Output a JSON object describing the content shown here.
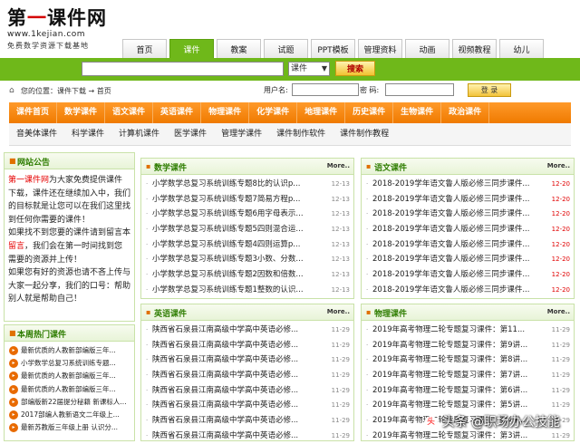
{
  "logo": {
    "title_a": "第",
    "title_b": "一",
    "title_c": "课件网",
    "domain": "www.1kejian.com",
    "slogan": "免费数学资源下载基地"
  },
  "nav": {
    "tabs": [
      "首页",
      "课件",
      "教案",
      "试题",
      "PPT模板",
      "管理资料",
      "动画",
      "视频教程",
      "幼儿"
    ],
    "active": 1
  },
  "search": {
    "select_value": "课件",
    "button": "搜索"
  },
  "infobar": {
    "location_label": "您的位置：课件下载 → 首页",
    "user_label": "用户名:",
    "pw_label": "密 码:",
    "login_button": "登 录"
  },
  "categories": {
    "row1": [
      "课件首页",
      "数学课件",
      "语文课件",
      "英语课件",
      "物理课件",
      "化学课件",
      "地理课件",
      "历史课件",
      "生物课件",
      "政治课件"
    ],
    "row2": [
      "音美体课件",
      "科学课件",
      "计算机课件",
      "医学课件",
      "管理学课件",
      "课件制作软件",
      "课件制作教程"
    ]
  },
  "announce": {
    "title": "网站公告",
    "site": "第一课件网",
    "p1": "为大家免费提供课件下载，课件还在继续加入中，我们的目标就是让您可以在我们这里找到任何你需要的课件！",
    "p2a": "如果找不到您要的课件请到留言本",
    "p2b": "留言",
    "p2c": "，我们会在第一时间找到您需要的资源并上传！",
    "p3": "如果您有好的资源也请不吝上传与大家一起分享，我们的口号：帮助别人就是帮助自己！"
  },
  "hot": {
    "title": "本周热门课件",
    "items": [
      "最新优质的人教新部编版三年...",
      "小学数学总复习系统训练专题...",
      "最新优质的人教新部编版三年...",
      "最新优质的人教新部编版三年...",
      "部编版新22届提分秘籍  新课标人...",
      "2017部编人教新语文二年级上...",
      "最新苏教版三年级上册 认识分..."
    ]
  },
  "sections": [
    {
      "title": "数学课件",
      "more": "More..",
      "items": [
        {
          "t": "小学数学总复习系统训练专题8比的认识p...",
          "d": "12-13"
        },
        {
          "t": "小学数学总复习系统训练专题7简易方程p...",
          "d": "12-13"
        },
        {
          "t": "小学数学总复习系统训练专题6用字母表示...",
          "d": "12-13"
        },
        {
          "t": "小学数学总复习系统训练专题5四则混合运...",
          "d": "12-13"
        },
        {
          "t": "小学数学总复习系统训练专题4四则运算p...",
          "d": "12-13"
        },
        {
          "t": "小学数学总复习系统训练专题3小数、分数...",
          "d": "12-13"
        },
        {
          "t": "小学数学总复习系统训练专题2因数和倍数...",
          "d": "12-13"
        },
        {
          "t": "小学数学总复习系统训练专题1整数的认识...",
          "d": "12-13"
        }
      ]
    },
    {
      "title": "语文课件",
      "more": "More..",
      "items": [
        {
          "t": "2018-2019学年语文鲁人版必修三同步课件...",
          "d": "12-20",
          "red": true
        },
        {
          "t": "2018-2019学年语文鲁人版必修三同步课件...",
          "d": "12-20",
          "red": true
        },
        {
          "t": "2018-2019学年语文鲁人版必修三同步课件...",
          "d": "12-20",
          "red": true
        },
        {
          "t": "2018-2019学年语文鲁人版必修三同步课件...",
          "d": "12-20",
          "red": true
        },
        {
          "t": "2018-2019学年语文鲁人版必修三同步课件...",
          "d": "12-20",
          "red": true
        },
        {
          "t": "2018-2019学年语文鲁人版必修三同步课件...",
          "d": "12-20",
          "red": true
        },
        {
          "t": "2018-2019学年语文鲁人版必修三同步课件...",
          "d": "12-20",
          "red": true
        },
        {
          "t": "2018-2019学年语文鲁人版必修三同步课件...",
          "d": "12-20",
          "red": true
        }
      ]
    },
    {
      "title": "英语课件",
      "more": "More..",
      "items": [
        {
          "t": "陕西省石泉县江南高级中学高中英语必修...",
          "d": "11-29"
        },
        {
          "t": "陕西省石泉县江南高级中学高中英语必修...",
          "d": "11-29"
        },
        {
          "t": "陕西省石泉县江南高级中学高中英语必修...",
          "d": "11-29"
        },
        {
          "t": "陕西省石泉县江南高级中学高中英语必修...",
          "d": "11-29"
        },
        {
          "t": "陕西省石泉县江南高级中学高中英语必修...",
          "d": "11-29"
        },
        {
          "t": "陕西省石泉县江南高级中学高中英语必修...",
          "d": "11-29"
        },
        {
          "t": "陕西省石泉县江南高级中学高中英语必修...",
          "d": "11-29"
        },
        {
          "t": "陕西省石泉县江南高级中学高中英语必修...",
          "d": "11-29"
        }
      ]
    },
    {
      "title": "物理课件",
      "more": "More..",
      "items": [
        {
          "t": "2019年高考物理二轮专题复习课件：第11...",
          "d": "11-29"
        },
        {
          "t": "2019年高考物理二轮专题复习课件：第9讲...",
          "d": "11-29"
        },
        {
          "t": "2019年高考物理二轮专题复习课件：第8讲...",
          "d": "11-29"
        },
        {
          "t": "2019年高考物理二轮专题复习课件：第7讲...",
          "d": "11-29"
        },
        {
          "t": "2019年高考物理二轮专题复习课件：第6讲...",
          "d": "11-29"
        },
        {
          "t": "2019年高考物理二轮专题复习课件：第5讲...",
          "d": "11-29"
        },
        {
          "t": "2019年高考物理二轮专题复习课件：第4讲...",
          "d": "11-29"
        },
        {
          "t": "2019年高考物理二轮专题复习课件：第3讲...",
          "d": "11-29"
        }
      ]
    }
  ],
  "watermark": {
    "icon": "头",
    "text": "头条 @职场办公技能"
  }
}
